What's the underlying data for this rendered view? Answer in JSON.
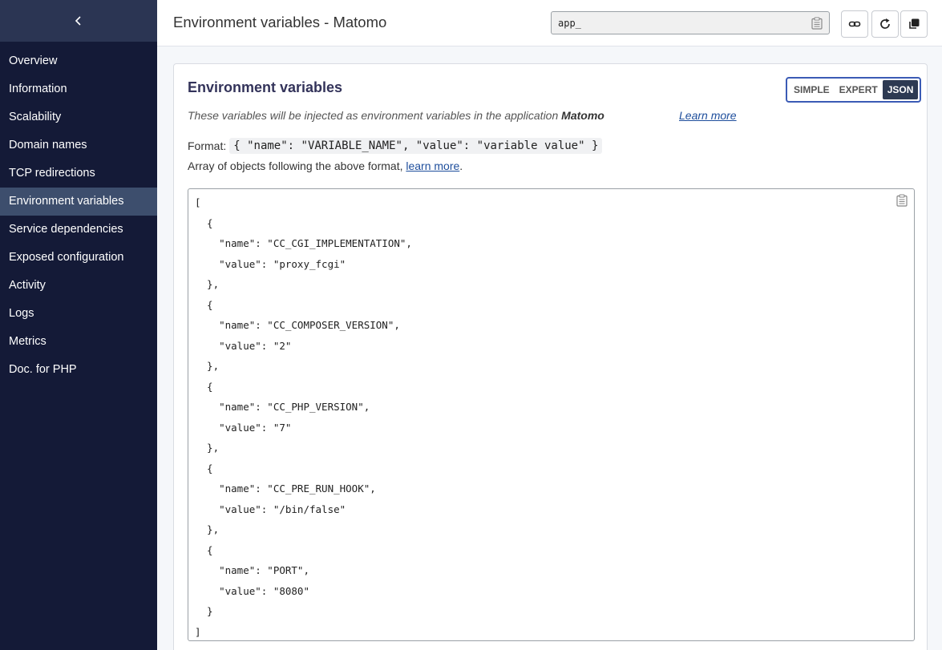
{
  "sidebar": {
    "back_icon": "chevron-left-icon",
    "items": [
      {
        "label": "Overview"
      },
      {
        "label": "Information"
      },
      {
        "label": "Scalability"
      },
      {
        "label": "Domain names"
      },
      {
        "label": "TCP redirections"
      },
      {
        "label": "Environment variables",
        "active": true
      },
      {
        "label": "Service dependencies"
      },
      {
        "label": "Exposed configuration"
      },
      {
        "label": "Activity"
      },
      {
        "label": "Logs"
      },
      {
        "label": "Metrics"
      },
      {
        "label": "Doc. for PHP"
      }
    ]
  },
  "header": {
    "title": "Environment variables - Matomo",
    "app_id": "app_",
    "buttons": [
      "link-icon",
      "refresh-icon",
      "copy-icon"
    ]
  },
  "card": {
    "title": "Environment variables",
    "modes": [
      "SIMPLE",
      "EXPERT",
      "JSON"
    ],
    "selected_mode": "JSON",
    "description": "These variables will be injected as environment variables in the application",
    "app_name": "Matomo",
    "learn_more": "Learn more",
    "format_label": "Format:",
    "format_code": "{ \"name\": \"VARIABLE_NAME\", \"value\": \"variable value\" }",
    "array_text": "Array of objects following the above format,",
    "array_link": "learn more",
    "array_end": "."
  },
  "editor": {
    "lines": [
      "[",
      "  {",
      "    \"name\": \"CC_CGI_IMPLEMENTATION\",",
      "    \"value\": \"proxy_fcgi\"",
      "  },",
      "  {",
      "    \"name\": \"CC_COMPOSER_VERSION\",",
      "    \"value\": \"2\"",
      "  },",
      "  {",
      "    \"name\": \"CC_PHP_VERSION\",",
      "    \"value\": \"7\"",
      "  },",
      "  {",
      "    \"name\": \"CC_PRE_RUN_HOOK\",",
      "    \"value\": \"/bin/false\"",
      "  },",
      "  {",
      "    \"name\": \"PORT\",",
      "    \"value\": \"8080\"",
      "  }",
      "]"
    ]
  }
}
